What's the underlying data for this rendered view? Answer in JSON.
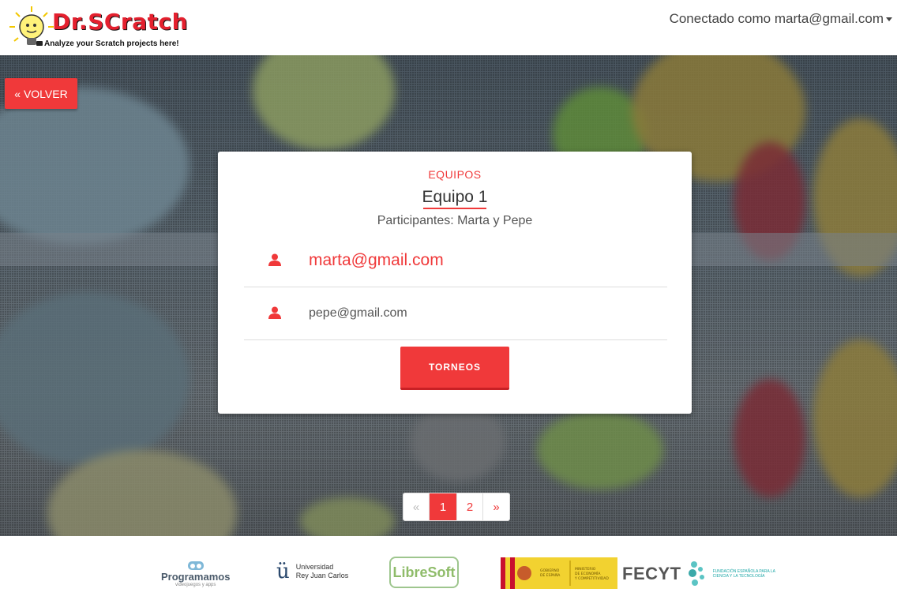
{
  "header": {
    "logo_title": "Dr.SCratch",
    "logo_subtitle": "Analyze your Scratch projects here!",
    "user_label": "Conectado como marta@gmail.com"
  },
  "back_button_label": "« VOLVER",
  "card": {
    "kicker": "EQUIPOS",
    "title": "Equipo 1",
    "participants": "Participantes: Marta y Pepe",
    "members": [
      {
        "email": "marta@gmail.com",
        "icon": "user-icon"
      },
      {
        "email": "pepe@gmail.com",
        "icon": "user-icon"
      }
    ],
    "button_label": "TORNEOS"
  },
  "pagination": {
    "prev": "«",
    "pages": [
      "1",
      "2"
    ],
    "active": "1",
    "next": "»"
  },
  "footer": {
    "sponsors": {
      "programamos": "Programamos",
      "programamos_tagline": "videojuegos y apps",
      "urjc_line1": "Universidad",
      "urjc_line2": "Rey Juan Carlos",
      "libresoft": "LibreSoft",
      "gobierno": "GOBIERNO DE ESPAÑA",
      "ministerio": "MINISTERIO DE ECONOMÍA Y COMPETITIVIDAD",
      "fecyt": "FECYT",
      "fecyt_sub": "FUNDACIÓN ESPAÑOLA PARA LA CIENCIA Y LA TECNOLOGÍA"
    }
  },
  "colors": {
    "accent": "#f0393a",
    "logo_red": "#e4202e"
  }
}
